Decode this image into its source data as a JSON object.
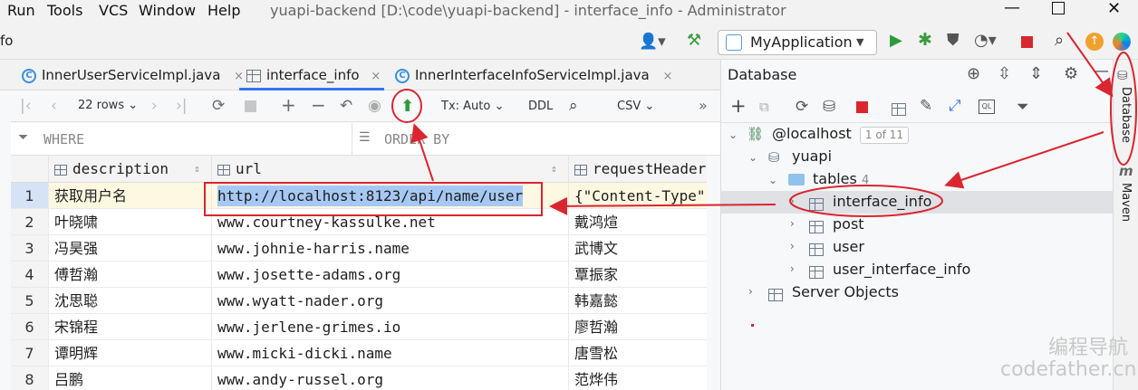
{
  "menus": [
    "Run",
    "Tools",
    "VCS",
    "Window",
    "Help"
  ],
  "window_title": "yuapi-backend [D:\\code\\yuapi-backend] - interface_info - Administrator",
  "left_cut_label": "fo",
  "run_config": "MyApplication",
  "tabs": [
    {
      "label": "InnerUserServiceImpl.java",
      "icon": "class-icon",
      "active": false
    },
    {
      "label": "interface_info",
      "icon": "table-icon",
      "active": true
    },
    {
      "label": "InnerInterfaceInfoServiceImpl.java",
      "icon": "class-icon",
      "active": false
    }
  ],
  "grid_toolbar": {
    "rows": "22 rows",
    "tx": "Tx: Auto",
    "ddl": "DDL",
    "export": "CSV",
    "more": "»"
  },
  "filter": {
    "where": "WHERE",
    "order_by": "ORDER BY"
  },
  "columns": [
    "description",
    "url",
    "requestHeader"
  ],
  "rows": [
    {
      "n": "1",
      "description": "获取用户名",
      "url": "http://localhost:8123/api/name/user",
      "header": "{\"Content-Type\":"
    },
    {
      "n": "2",
      "description": "叶晓啸",
      "url": "www.courtney-kassulke.net",
      "header": "戴鸿煊"
    },
    {
      "n": "3",
      "description": "冯昊强",
      "url": "www.johnie-harris.name",
      "header": "武博文"
    },
    {
      "n": "4",
      "description": "傅哲瀚",
      "url": "www.josette-adams.org",
      "header": "覃振家"
    },
    {
      "n": "5",
      "description": "沈思聪",
      "url": "www.wyatt-nader.org",
      "header": "韩嘉懿"
    },
    {
      "n": "6",
      "description": "宋锦程",
      "url": "www.jerlene-grimes.io",
      "header": "廖哲瀚"
    },
    {
      "n": "7",
      "description": "谭明辉",
      "url": "www.micki-dicki.name",
      "header": "唐雪松"
    },
    {
      "n": "8",
      "description": "吕鹏",
      "url": "www.andy-russel.org",
      "header": "范烨伟"
    }
  ],
  "db_panel": {
    "title": "Database",
    "host": "@localhost",
    "host_badge": "1 of 11",
    "schema": "yuapi",
    "tables_label": "tables",
    "tables_count": "4",
    "tables": [
      "interface_info",
      "post",
      "user",
      "user_interface_info"
    ],
    "server_objects": "Server Objects"
  },
  "side_tabs": {
    "database": "Database",
    "maven": "Maven"
  },
  "watermark": {
    "line1": "编程导航",
    "line2": "codefather.cn"
  },
  "colors": {
    "accent": "#3574f0",
    "annotation": "#d9262f",
    "run": "#2e9b3a",
    "selected_cell": "#a6c8f4",
    "row_highlight": "#fdf8e1"
  }
}
